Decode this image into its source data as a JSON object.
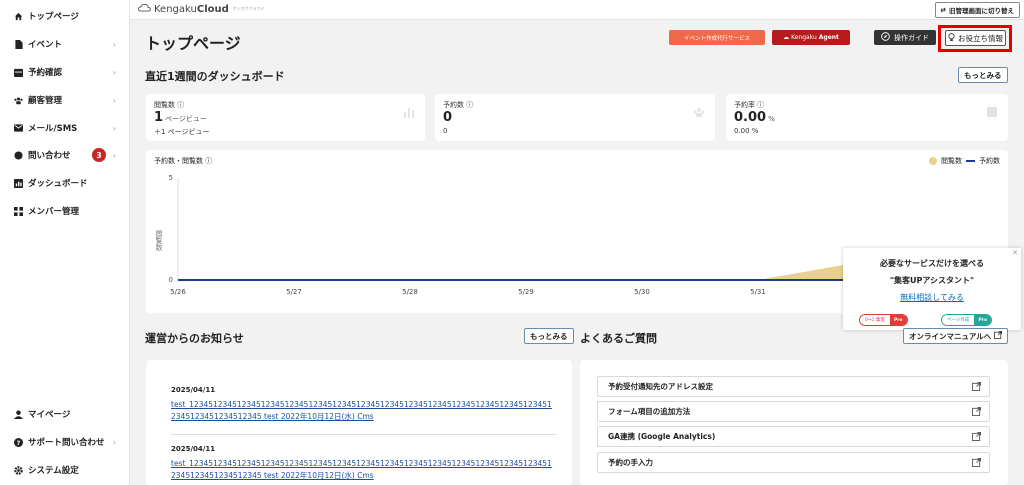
{
  "app": {
    "logo_text": "Kengaku",
    "logo_bold": "Cloud",
    "logo_tag": "ケンガククラウド",
    "switch_label": "旧管理画面に切り替え"
  },
  "sidebar": {
    "items": [
      {
        "label": "トップページ",
        "icon": "home-icon"
      },
      {
        "label": "イベント",
        "icon": "document-icon"
      },
      {
        "label": "予約確認",
        "icon": "calendar-icon"
      },
      {
        "label": "顧客管理",
        "icon": "people-icon"
      },
      {
        "label": "メール/SMS",
        "icon": "mail-icon"
      },
      {
        "label": "問い合わせ",
        "icon": "chat-icon",
        "badge": "3"
      },
      {
        "label": "ダッシュボード",
        "icon": "dashboard-icon"
      },
      {
        "label": "メンバー管理",
        "icon": "grid-icon"
      }
    ],
    "bottom": [
      {
        "label": "マイページ",
        "icon": "user-icon"
      },
      {
        "label": "サポート問い合わせ",
        "icon": "help-icon"
      },
      {
        "label": "システム設定",
        "icon": "gear-icon"
      }
    ]
  },
  "header": {
    "title": "トップページ",
    "event_btn": "イベント作成代行サービス",
    "agent_btn_prefix": "Kengaku",
    "agent_btn_bold": "Agent",
    "guide_btn": "操作ガイド",
    "tips_btn": "お役立ち情報"
  },
  "dashboard": {
    "title": "直近1週間のダッシュボード",
    "more": "もっとみる",
    "stats": [
      {
        "label": "閲覧数",
        "value": "1",
        "unit": "ページビュー",
        "sub": "＋1 ページビュー"
      },
      {
        "label": "予約数",
        "value": "0",
        "unit": "",
        "sub": "0"
      },
      {
        "label": "予約率",
        "value": "0.00",
        "unit": "%",
        "sub": "0.00 %"
      }
    ]
  },
  "chart_data": {
    "type": "line",
    "title": "予約数・閲覧数",
    "ylabel": "閲覧数",
    "x": [
      "5/26",
      "5/27",
      "5/28",
      "5/29",
      "5/30",
      "5/31",
      "6/1"
    ],
    "ylim": [
      0,
      5
    ],
    "y_ticks": [
      "5",
      "0"
    ],
    "series": [
      {
        "name": "閲覧数",
        "type": "area",
        "color": "#e8d18e",
        "values": [
          0,
          0,
          0,
          0,
          0,
          0,
          1
        ]
      },
      {
        "name": "予約数",
        "type": "line",
        "color": "#1e3a8a",
        "values": [
          0,
          0,
          0,
          0,
          0,
          0,
          0
        ]
      }
    ]
  },
  "popup": {
    "line1": "必要なサービスだけを選べる",
    "line2": "\"集客UPアシスタント\"",
    "link": "無料相談してみる",
    "pill1_a": "0→1 集客",
    "pill1_b": "Pro",
    "pill2_a": "ページ作成",
    "pill2_b": "Pro"
  },
  "news": {
    "title": "運営からのお知らせ",
    "more": "もっとみる",
    "items": [
      {
        "date": "2025/04/11",
        "text": "test_12345123451234512345123451234512345123451234512345123451234512345123451234512345123451234512345 test 2022年10月12日(水) Cms"
      },
      {
        "date": "2025/04/11",
        "text": "test_12345123451234512345123451234512345123451234512345123451234512345123451234512345123451234512345 test 2022年10月12日(水) Cms"
      }
    ]
  },
  "faq": {
    "title": "よくあるご質問",
    "manual_btn": "オンラインマニュアルへ",
    "items": [
      "予約受付通知先のアドレス設定",
      "フォーム項目の追加方法",
      "GA連携 (Google Analytics)",
      "予約の手入力"
    ]
  }
}
